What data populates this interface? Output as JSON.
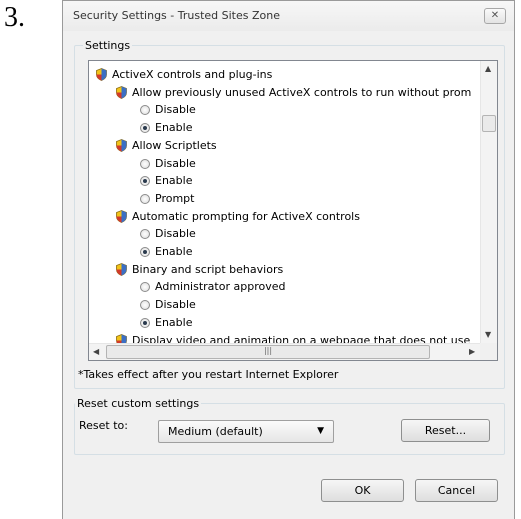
{
  "step": "3.",
  "dialog": {
    "title": "Security Settings - Trusted Sites Zone",
    "close_icon": "close-icon"
  },
  "settings": {
    "group_label": "Settings",
    "tree": [
      {
        "kind": "header",
        "text": "ActiveX controls and plug-ins",
        "level": 0
      },
      {
        "kind": "setting",
        "text": "Allow previously unused ActiveX controls to run without prom",
        "level": 1
      },
      {
        "kind": "option",
        "text": "Disable",
        "selected": false
      },
      {
        "kind": "option",
        "text": "Enable",
        "selected": true
      },
      {
        "kind": "setting",
        "text": "Allow Scriptlets",
        "level": 1
      },
      {
        "kind": "option",
        "text": "Disable",
        "selected": false
      },
      {
        "kind": "option",
        "text": "Enable",
        "selected": true
      },
      {
        "kind": "option",
        "text": "Prompt",
        "selected": false
      },
      {
        "kind": "setting",
        "text": "Automatic prompting for ActiveX controls",
        "level": 1
      },
      {
        "kind": "option",
        "text": "Disable",
        "selected": false
      },
      {
        "kind": "option",
        "text": "Enable",
        "selected": true
      },
      {
        "kind": "setting",
        "text": "Binary and script behaviors",
        "level": 1
      },
      {
        "kind": "option",
        "text": "Administrator approved",
        "selected": false
      },
      {
        "kind": "option",
        "text": "Disable",
        "selected": false
      },
      {
        "kind": "option",
        "text": "Enable",
        "selected": true
      },
      {
        "kind": "setting",
        "text": "Display video and animation on a webpage that does not use",
        "level": 1
      }
    ],
    "note": "*Takes effect after you restart Internet Explorer"
  },
  "reset": {
    "group_label": "Reset custom settings",
    "label": "Reset to:",
    "selected": "Medium (default)",
    "button": "Reset..."
  },
  "buttons": {
    "ok": "OK",
    "cancel": "Cancel"
  },
  "colors": {
    "dialog_bg": "#f0f0f0",
    "list_border": "#828790",
    "radio_dot": "#2b3b4e"
  }
}
